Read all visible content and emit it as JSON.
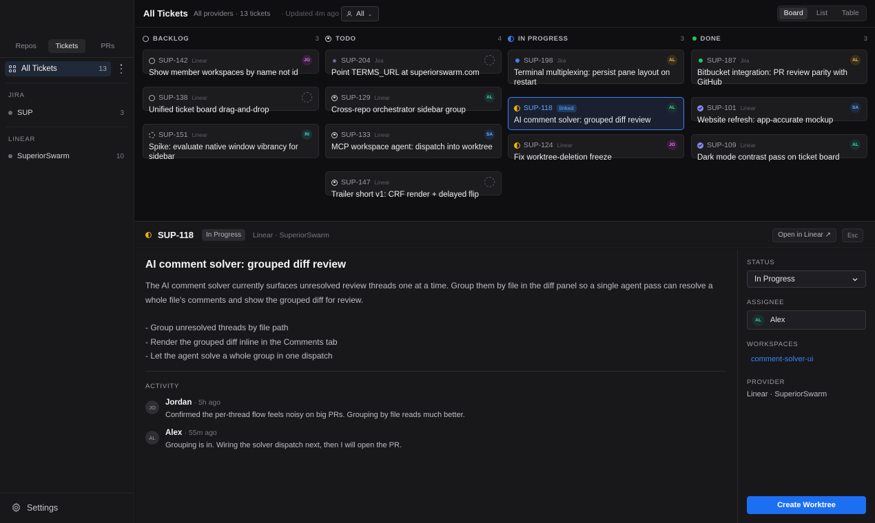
{
  "sidebar": {
    "tabs": [
      "Repos",
      "Tickets",
      "PRs"
    ],
    "active_tab": "Tickets",
    "all_tickets": {
      "label": "All Tickets",
      "count": "13"
    },
    "groups": [
      {
        "heading": "JIRA",
        "items": [
          {
            "label": "SUP",
            "count": "3"
          }
        ]
      },
      {
        "heading": "LINEAR",
        "items": [
          {
            "label": "SuperiorSwarm",
            "count": "10"
          }
        ]
      }
    ],
    "settings_label": "Settings"
  },
  "header": {
    "title": "All Tickets",
    "meta": "All providers · 13 tickets",
    "updated": "· Updated 4m ago",
    "filter_label": "All",
    "views": [
      "Board",
      "List",
      "Table"
    ],
    "active_view": "Board"
  },
  "board": {
    "columns": [
      {
        "name": "BACKLOG",
        "count": "3",
        "cards": [
          {
            "id": "SUP-142",
            "provider": "Linear",
            "title": "Show member workspaces by name not id",
            "assignee": "JO"
          },
          {
            "id": "SUP-138",
            "provider": "Linear",
            "title": "Unified ticket board drag-and-drop",
            "assignee": ""
          },
          {
            "id": "SUP-151",
            "provider": "Linear",
            "title": "Spike: evaluate native window vibrancy for sidebar",
            "assignee": "RI"
          }
        ]
      },
      {
        "name": "TODO",
        "count": "4",
        "cards": [
          {
            "id": "SUP-204",
            "provider": "Jira",
            "title": "Point TERMS_URL at superiorswarm.com",
            "assignee": ""
          },
          {
            "id": "SUP-129",
            "provider": "Linear",
            "title": "Cross-repo orchestrator sidebar group",
            "assignee": "AL"
          },
          {
            "id": "SUP-133",
            "provider": "Linear",
            "title": "MCP workspace agent: dispatch into worktree",
            "assignee": "SA"
          },
          {
            "id": "SUP-147",
            "provider": "Linear",
            "title": "Trailer short v1: CRF render + delayed flip",
            "assignee": ""
          }
        ]
      },
      {
        "name": "IN PROGRESS",
        "count": "3",
        "cards": [
          {
            "id": "SUP-198",
            "provider": "Jira",
            "title": "Terminal multiplexing: persist pane layout on restart",
            "assignee": "AL"
          },
          {
            "id": "SUP-118",
            "provider": "",
            "badge": "linked",
            "title": "AI comment solver: grouped diff review",
            "assignee": "AL"
          },
          {
            "id": "SUP-124",
            "provider": "Linear",
            "title": "Fix worktree-deletion freeze",
            "assignee": "JO"
          }
        ]
      },
      {
        "name": "DONE",
        "count": "3",
        "cards": [
          {
            "id": "SUP-187",
            "provider": "Jira",
            "title": "Bitbucket integration: PR review parity with GitHub",
            "assignee": "AL"
          },
          {
            "id": "SUP-101",
            "provider": "Linear",
            "title": "Website refresh: app-accurate mockup",
            "assignee": "SA"
          },
          {
            "id": "SUP-109",
            "provider": "Linear",
            "title": "Dark mode contrast pass on ticket board",
            "assignee": "AL"
          }
        ]
      }
    ]
  },
  "detail": {
    "id": "SUP-118",
    "status_badge": "In Progress",
    "meta": "Linear · SuperiorSwarm",
    "open_button": "Open in Linear ↗",
    "esc_button": "Esc",
    "title": "AI comment solver: grouped diff review",
    "description": "The AI comment solver currently surfaces unresolved review threads one at a time. Group them by file in the diff panel so a single agent pass can resolve a whole file's comments and show the grouped diff for review.",
    "bullets": [
      "- Group unresolved threads by file path",
      "- Render the grouped diff inline in the Comments tab",
      "- Let the agent solve a whole group in one dispatch"
    ],
    "activity_heading": "ACTIVITY",
    "activity": [
      {
        "initials": "JO",
        "author": "Jordan",
        "time": "· 5h ago",
        "text": "Confirmed the per-thread flow feels noisy on big PRs. Grouping by file reads much better."
      },
      {
        "initials": "AL",
        "author": "Alex",
        "time": "· 55m ago",
        "text": "Grouping is in. Wiring the solver dispatch next, then I will open the PR."
      }
    ],
    "side": {
      "status_label": "STATUS",
      "status_value": "In Progress",
      "assignee_label": "ASSIGNEE",
      "assignee_initials": "AL",
      "assignee_name": "Alex",
      "workspaces_label": "WORKSPACES",
      "workspace_link": "comment-solver-ui",
      "provider_label": "PROVIDER",
      "provider_value": "Linear · SuperiorSwarm",
      "create_button": "Create Worktree"
    }
  },
  "colors": {
    "accent": "#1d6ff2",
    "selected_border": "#3b82f6",
    "in_progress": "#eab308",
    "done": "#8b8bf0",
    "done_dot": "#22c55e"
  }
}
